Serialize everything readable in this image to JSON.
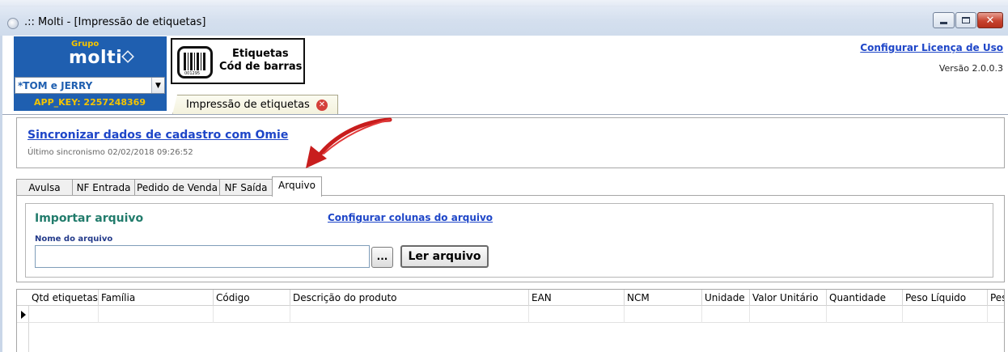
{
  "window": {
    "title": ".:: Molti - [Impressão de etiquetas]",
    "close_glyph": "✕"
  },
  "brand": {
    "grupo": "Grupo",
    "name": "molti",
    "brand_color": "#1f5fb0",
    "key_color": "#f4c400"
  },
  "company": {
    "selected": "*TOM e JERRY",
    "dropdown_glyph": "▼",
    "app_key": "APP_KEY: 2257248369"
  },
  "barcode_button": {
    "line1": "Etiquetas",
    "line2": "Cód de barras",
    "code_digits": "001295"
  },
  "doc_tab": {
    "label": "Impressão de etiquetas",
    "close_glyph": "✕"
  },
  "header": {
    "license_link": "Configurar Licença de Uso",
    "version": "Versão 2.0.0.3"
  },
  "sync": {
    "link": "Sincronizar dados de cadastro com Omie",
    "last_sync": "Último sincronismo 02/02/2018 09:26:52"
  },
  "tabs": [
    {
      "label": "Avulsa"
    },
    {
      "label": "NF Entrada"
    },
    {
      "label": "Pedido de Venda"
    },
    {
      "label": "NF Saída"
    },
    {
      "label": "Arquivo",
      "active": true
    }
  ],
  "import": {
    "title": "Importar arquivo",
    "config_link": "Configurar colunas do arquivo",
    "filename_label": "Nome do arquivo",
    "filename_value": "",
    "browse_label": "...",
    "read_label": "Ler arquivo"
  },
  "grid": {
    "columns": [
      "Qtd etiquetas",
      "Família",
      "Código",
      "Descrição do produto",
      "EAN",
      "NCM",
      "Unidade",
      "Valor Unitário",
      "Quantidade",
      "Peso Líquido",
      "Pes"
    ],
    "rows": [
      [
        "",
        "",
        "",
        "",
        "",
        "",
        "",
        "",
        "",
        "",
        ""
      ]
    ]
  },
  "icons": {
    "app": "app-icon",
    "annotation": "red-arrow-icon",
    "barcode": "barcode-icon",
    "row_indicator": "row-pointer-icon"
  }
}
